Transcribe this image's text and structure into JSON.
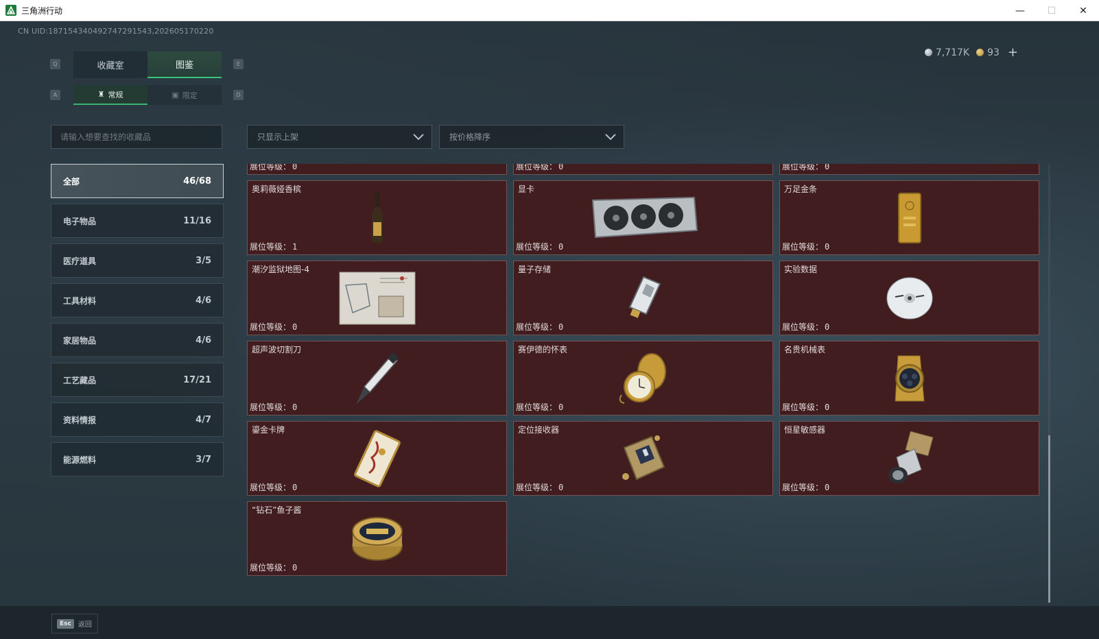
{
  "window": {
    "title": "三角洲行动",
    "minimize": "—",
    "maximize": "☐",
    "close": "✕"
  },
  "header": {
    "uid": "CN UID:187154340492747291543,202605170220",
    "currency": [
      {
        "icon": "silver-coin-icon",
        "value": "7,717K"
      },
      {
        "icon": "gold-coin-icon",
        "value": "93"
      }
    ],
    "plus": "+"
  },
  "keys": {
    "q": "Q",
    "e": "E",
    "a": "A",
    "d": "D"
  },
  "tabs": [
    {
      "label": "收藏室",
      "active": false
    },
    {
      "label": "图鉴",
      "active": true
    }
  ],
  "subtabs": [
    {
      "label": "常规",
      "active": true
    },
    {
      "label": "限定",
      "active": false
    }
  ],
  "search": {
    "placeholder": "请输入想要查找的收藏品"
  },
  "filters": {
    "listing": "只显示上架",
    "sort": "按价格降序"
  },
  "categories": [
    {
      "label": "全部",
      "count": "46/68",
      "active": true
    },
    {
      "label": "电子物品",
      "count": "11/16"
    },
    {
      "label": "医疗道具",
      "count": "3/5"
    },
    {
      "label": "工具材料",
      "count": "4/6"
    },
    {
      "label": "家居物品",
      "count": "4/6"
    },
    {
      "label": "工艺藏品",
      "count": "17/21"
    },
    {
      "label": "资料情报",
      "count": "4/7"
    },
    {
      "label": "能源燃料",
      "count": "3/7"
    }
  ],
  "level_label": "展位等级：",
  "items": [
    {
      "name": "",
      "level": "0",
      "icon": "partial-item"
    },
    {
      "name": "",
      "level": "0",
      "icon": "partial-item"
    },
    {
      "name": "",
      "level": "0",
      "icon": "partial-item"
    },
    {
      "name": "奥莉薇娅香槟",
      "level": "1",
      "icon": "champagne-bottle-icon"
    },
    {
      "name": "显卡",
      "level": "0",
      "icon": "graphics-card-icon"
    },
    {
      "name": "万足金条",
      "level": "0",
      "icon": "gold-bar-icon"
    },
    {
      "name": "潮汐监狱地图-4",
      "level": "0",
      "icon": "prison-map-icon"
    },
    {
      "name": "量子存储",
      "level": "0",
      "icon": "quantum-storage-icon"
    },
    {
      "name": "实验数据",
      "level": "0",
      "icon": "data-disc-icon"
    },
    {
      "name": "超声波切割刀",
      "level": "0",
      "icon": "ultrasonic-cutter-icon"
    },
    {
      "name": "赛伊德的怀表",
      "level": "0",
      "icon": "pocket-watch-icon"
    },
    {
      "name": "名贵机械表",
      "level": "0",
      "icon": "luxury-watch-icon"
    },
    {
      "name": "鎏金卡牌",
      "level": "0",
      "icon": "gilded-card-icon"
    },
    {
      "name": "定位接收器",
      "level": "0",
      "icon": "gps-receiver-icon"
    },
    {
      "name": "恒星敏感器",
      "level": "0",
      "icon": "star-sensor-icon"
    },
    {
      "name": "“钻石”鱼子酱",
      "level": "0",
      "icon": "caviar-tin-icon"
    }
  ],
  "footer": {
    "esc_key": "Esc",
    "back_label": "返回"
  },
  "colors": {
    "card_bg": "#421d20",
    "card_border": "#705456",
    "accent_green": "#3ac47a"
  }
}
